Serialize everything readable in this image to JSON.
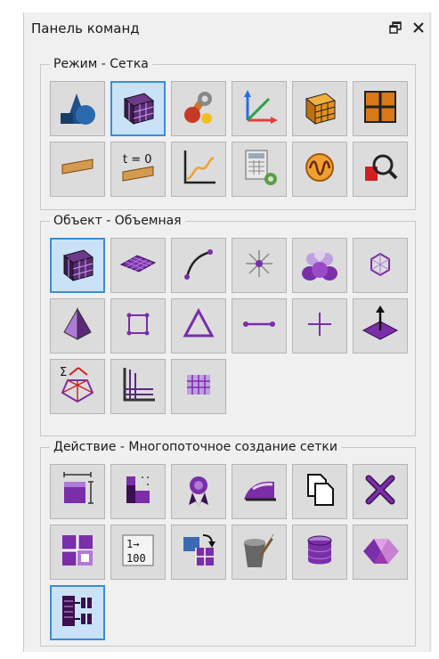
{
  "panel": {
    "title": "Панель команд",
    "float_icon": "float-window-icon",
    "close_icon": "close-icon"
  },
  "groups": [
    {
      "label": "Режим - Сетка",
      "buttons": [
        {
          "icon": "geometry-shapes-icon",
          "active": false
        },
        {
          "icon": "mesh-cube-icon",
          "active": true
        },
        {
          "icon": "wrench-tools-icon",
          "active": false
        },
        {
          "icon": "coordinate-axes-icon",
          "active": false
        },
        {
          "icon": "orange-grid-cube-icon",
          "active": false
        },
        {
          "icon": "orange-plane-grid-icon",
          "active": false
        },
        {
          "icon": "plank-icon",
          "active": false
        },
        {
          "icon": "time-zero-plank-icon",
          "active": false,
          "text": "t = 0"
        },
        {
          "icon": "graph-curve-icon",
          "active": false
        },
        {
          "icon": "calculator-gear-icon",
          "active": false
        },
        {
          "icon": "wave-circle-icon",
          "active": false
        },
        {
          "icon": "inspect-magnifier-icon",
          "active": false
        }
      ]
    },
    {
      "label": "Объект - Объемная",
      "buttons": [
        {
          "icon": "volume-mesh-icon",
          "active": true
        },
        {
          "icon": "surface-mesh-icon",
          "active": false
        },
        {
          "icon": "curve-edge-icon",
          "active": false
        },
        {
          "icon": "node-star-icon",
          "active": false
        },
        {
          "icon": "group-people-icon",
          "active": false
        },
        {
          "icon": "polyhedron-icon",
          "active": false
        },
        {
          "icon": "tetrahedron-icon",
          "active": false
        },
        {
          "icon": "quad-element-icon",
          "active": false
        },
        {
          "icon": "triangle-element-icon",
          "active": false
        },
        {
          "icon": "line-element-icon",
          "active": false
        },
        {
          "icon": "point-element-icon",
          "active": false
        },
        {
          "icon": "normal-vector-icon",
          "active": false
        },
        {
          "icon": "sum-nodes-icon",
          "active": false,
          "text": "Σ"
        },
        {
          "icon": "corner-mesh-icon",
          "active": false
        },
        {
          "icon": "small-grid-icon",
          "active": false
        }
      ]
    },
    {
      "label": "Действие - Многопоточное создание сетки",
      "buttons": [
        {
          "icon": "size-block-icon",
          "active": false
        },
        {
          "icon": "block-stack-icon",
          "active": false
        },
        {
          "icon": "award-ribbon-icon",
          "active": false
        },
        {
          "icon": "iron-icon",
          "active": false
        },
        {
          "icon": "copy-pages-icon",
          "active": false
        },
        {
          "icon": "delete-cross-icon",
          "active": false
        },
        {
          "icon": "split-quad-icon",
          "active": false
        },
        {
          "icon": "numbering-icon",
          "active": false,
          "text_top": "1→",
          "text_bottom": "100"
        },
        {
          "icon": "swap-blocks-icon",
          "active": false
        },
        {
          "icon": "cleanup-bucket-icon",
          "active": false
        },
        {
          "icon": "database-cylinder-icon",
          "active": false
        },
        {
          "icon": "morph-shape-icon",
          "active": false
        },
        {
          "icon": "multithread-mesh-icon",
          "active": true
        }
      ]
    }
  ]
}
